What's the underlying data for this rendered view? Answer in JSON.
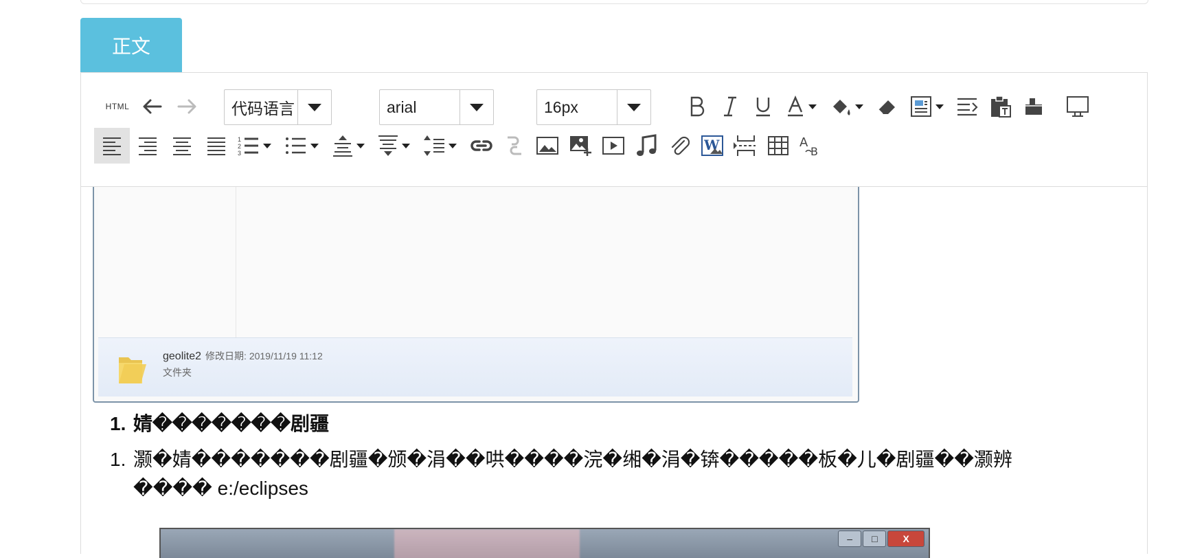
{
  "tab": {
    "label": "正文"
  },
  "toolbar": {
    "html_label": "HTML",
    "code_language": "代码语言",
    "font_family": "arial",
    "font_size": "16px"
  },
  "content": {
    "file": {
      "name": "geolite2",
      "date_label": "修改日期: 2019/11/19 11:12",
      "type": "文件夹"
    },
    "list": [
      {
        "num": "1.",
        "text": "婧�������剧疆",
        "bold": true
      },
      {
        "num": "1.",
        "text": "灏�婧�������剧疆�颁�涓��哄����浣�缃�涓�锛�����板�儿�剧疆��灏辨",
        "bold": false
      },
      {
        "num": "",
        "text": "���� e:/eclipses",
        "bold": false
      }
    ]
  },
  "window_controls": {
    "minimize": "–",
    "maximize": "□",
    "close": "X"
  },
  "colors": {
    "tab_bg": "#5bc0de",
    "border": "#dcdcdc",
    "active_bg": "#e2e2e2"
  }
}
